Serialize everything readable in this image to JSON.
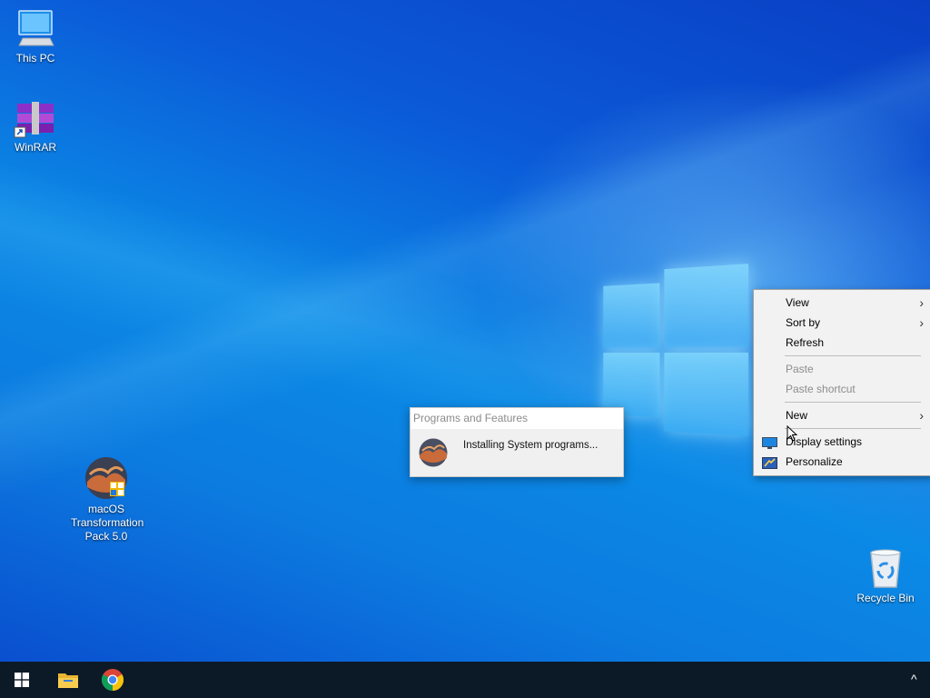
{
  "desktop": {
    "icons": [
      {
        "label": "This PC",
        "icon": "this-pc-icon"
      },
      {
        "label": "WinRAR",
        "icon": "winrar-icon"
      },
      {
        "label": "macOS Transformation Pack 5.0",
        "icon": "macos-transformation-pack-icon"
      },
      {
        "label": "Recycle Bin",
        "icon": "recycle-bin-icon"
      }
    ]
  },
  "popup": {
    "title": "Programs and Features",
    "message": "Installing System programs...",
    "icon": "macos-sierra-icon"
  },
  "context_menu": {
    "items": [
      {
        "label": "View",
        "submenu": true,
        "disabled": false
      },
      {
        "label": "Sort by",
        "submenu": true,
        "disabled": false
      },
      {
        "label": "Refresh",
        "submenu": false,
        "disabled": false
      },
      {
        "label": "Paste",
        "submenu": false,
        "disabled": true
      },
      {
        "label": "Paste shortcut",
        "submenu": false,
        "disabled": true
      },
      {
        "label": "New",
        "submenu": true,
        "disabled": false
      },
      {
        "label": "Display settings",
        "submenu": false,
        "disabled": false,
        "icon": "display-settings-icon"
      },
      {
        "label": "Personalize",
        "submenu": false,
        "disabled": false,
        "icon": "personalize-icon"
      }
    ],
    "submenu_arrow": "›"
  },
  "taskbar": {
    "buttons": [
      {
        "name": "start",
        "icon": "windows-start-icon"
      },
      {
        "name": "file-explorer",
        "icon": "folder-icon"
      },
      {
        "name": "chrome",
        "icon": "chrome-icon"
      }
    ],
    "tray_chevron": "^"
  },
  "colors": {
    "taskbar": "#0c1a27",
    "desktop_blue": "#0b7ee4"
  }
}
